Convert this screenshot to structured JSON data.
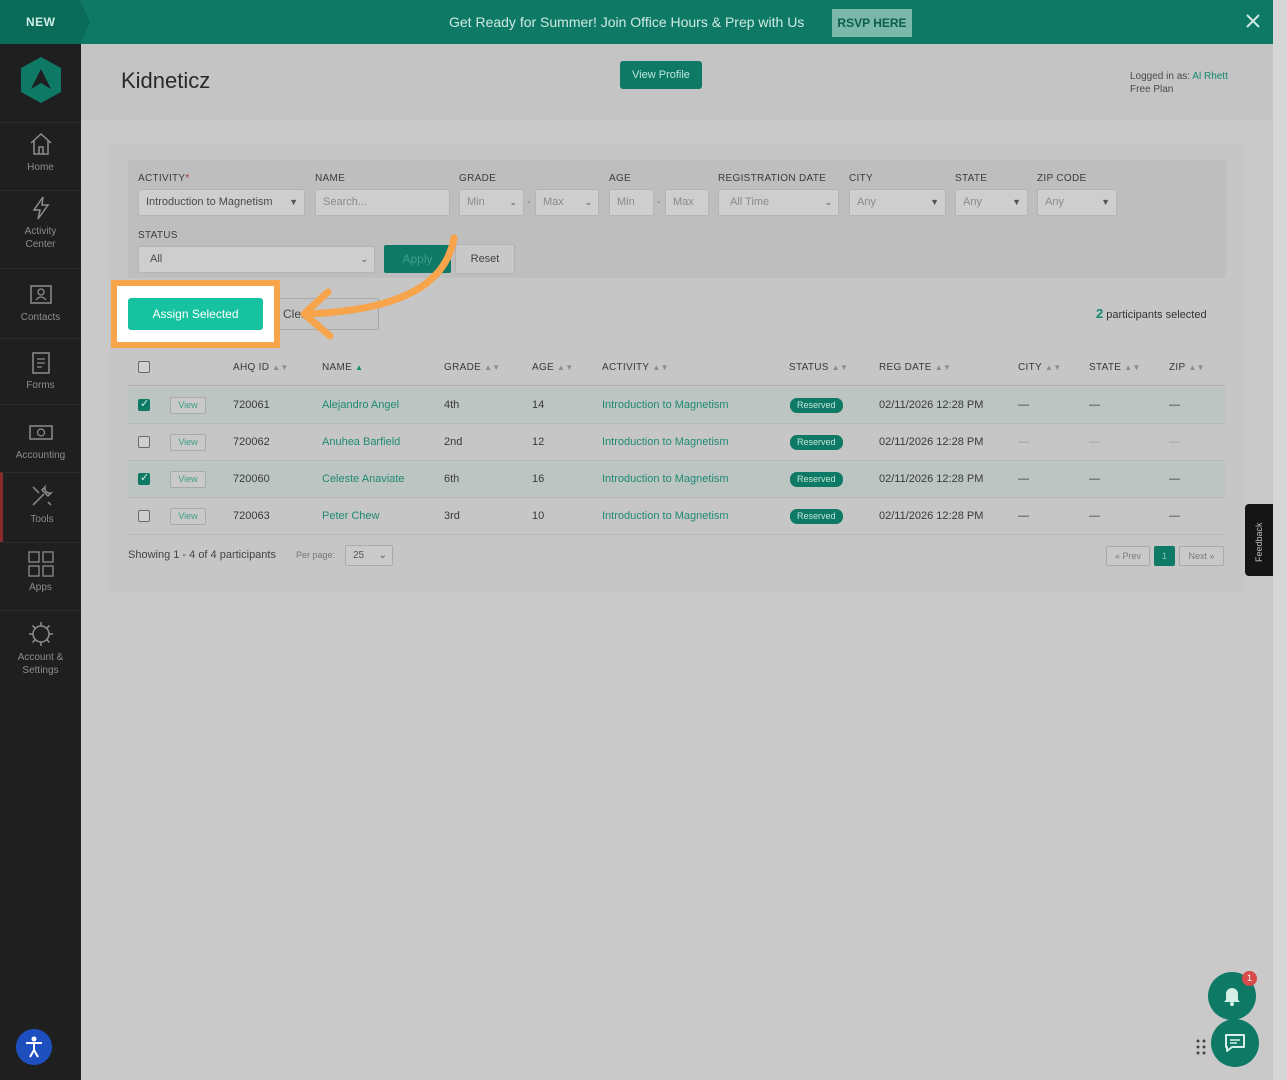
{
  "banner": {
    "new_label": "NEW",
    "message": "Get Ready for Summer! Join Office Hours & Prep with Us",
    "rsvp_label": "RSVP HERE",
    "close_icon": "close-icon"
  },
  "sidebar": {
    "items": [
      {
        "label": "Home",
        "icon": "home-icon"
      },
      {
        "label": "Activity Center",
        "icon": "lightning-icon"
      },
      {
        "label": "Contacts",
        "icon": "contacts-icon"
      },
      {
        "label": "Forms",
        "icon": "forms-icon"
      },
      {
        "label": "Accounting",
        "icon": "money-icon"
      },
      {
        "label": "Tools",
        "icon": "tools-icon"
      },
      {
        "label": "Apps",
        "icon": "apps-grid-icon"
      },
      {
        "label": "Account & Settings",
        "icon": "gear-icon"
      }
    ]
  },
  "header": {
    "title": "Kidneticz",
    "view_profile": "View Profile",
    "logged_prefix": "Logged in as:",
    "user_name": "Al Rhett",
    "plan": "Free Plan"
  },
  "filters": {
    "activity_label": "ACTIVITY",
    "activity_required": "*",
    "activity_value": "Introduction to Magnetism",
    "name_label": "NAME",
    "name_placeholder": "Search...",
    "grade_label": "GRADE",
    "grade_min": "Min",
    "grade_max": "Max",
    "age_label": "AGE",
    "age_min": "Min",
    "age_max": "Max",
    "reg_label": "REGISTRATION DATE",
    "reg_value": "All Time",
    "city_label": "CITY",
    "city_value": "Any",
    "state_label": "STATE",
    "state_value": "Any",
    "zip_label": "ZIP CODE",
    "zip_value": "Any",
    "status_label": "STATUS",
    "status_value": "All",
    "range_dash": "-",
    "apply_label": "Apply",
    "reset_label": "Reset"
  },
  "actions": {
    "assign_label": "Assign Selected",
    "clear_label": "Clear",
    "selected_count": "2",
    "selected_text": "participants selected"
  },
  "table": {
    "headers": [
      "AHQ ID",
      "NAME",
      "GRADE",
      "AGE",
      "ACTIVITY",
      "STATUS",
      "REG DATE",
      "CITY",
      "STATE",
      "ZIP"
    ],
    "view_label": "View",
    "rows": [
      {
        "checked": true,
        "id": "720061",
        "name": "Alejandro Angel",
        "grade": "4th",
        "age": "14",
        "activity": "Introduction to Magnetism",
        "status": "Reserved",
        "reg_date": "02/11/2026 12:28 PM",
        "city": "—",
        "state": "—",
        "zip": "—"
      },
      {
        "checked": false,
        "id": "720062",
        "name": "Anuhea Barfield",
        "grade": "2nd",
        "age": "12",
        "activity": "Introduction to Magnetism",
        "status": "Reserved",
        "reg_date": "02/11/2026 12:28 PM",
        "city": "—",
        "state": "—",
        "zip": "—"
      },
      {
        "checked": true,
        "id": "720060",
        "name": "Celeste Anaviate",
        "grade": "6th",
        "age": "16",
        "activity": "Introduction to Magnetism",
        "status": "Reserved",
        "reg_date": "02/11/2026 12:28 PM",
        "city": "—",
        "state": "—",
        "zip": "—"
      },
      {
        "checked": false,
        "id": "720063",
        "name": "Peter Chew",
        "grade": "3rd",
        "age": "10",
        "activity": "Introduction to Magnetism",
        "status": "Reserved",
        "reg_date": "02/11/2026 12:28 PM",
        "city": "—",
        "state": "—",
        "zip": "—"
      }
    ]
  },
  "footer": {
    "showing": "Showing 1 - 4 of 4 participants",
    "per_page_label": "Per page:",
    "per_page_value": "25",
    "prev": "« Prev",
    "current_page": "1",
    "next": "Next »"
  },
  "feedback_label": "Feedback",
  "notification_count": "1",
  "colors": {
    "brand": "#0e7a66",
    "assign": "#17c2a0",
    "highlight": "#f7a44a"
  }
}
